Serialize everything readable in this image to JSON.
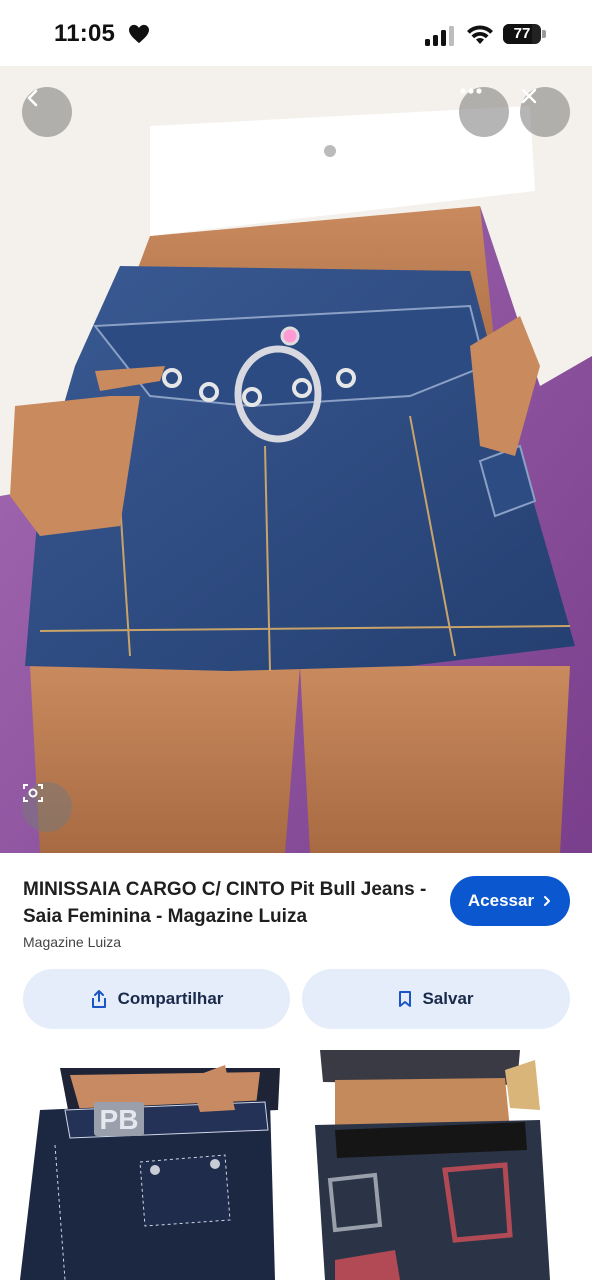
{
  "status_bar": {
    "time": "11:05",
    "battery_percent": "77"
  },
  "hero": {
    "icons": {
      "back": "arrow-back-icon",
      "more": "more-horizontal-icon",
      "close": "close-icon",
      "lens": "visual-search-icon"
    },
    "background_color": "#9a5ca8",
    "denim_color": "#2f4f86",
    "shirt_color": "#f4f1ec"
  },
  "product": {
    "title": "MINISSAIA CARGO C/ CINTO Pit Bull Jeans - Saia Feminina - Magazine Luiza",
    "source": "Magazine Luiza",
    "visit_label": "Acessar",
    "accent_color": "#0b57d0"
  },
  "actions": {
    "share_label": "Compartilhar",
    "save_label": "Salvar"
  },
  "related": {
    "left_logo": "PB"
  }
}
